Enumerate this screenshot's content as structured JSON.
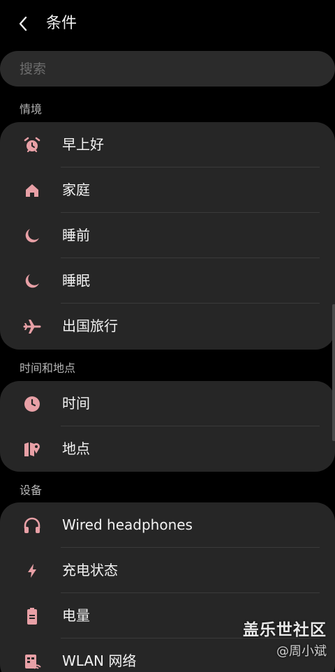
{
  "header": {
    "title": "条件",
    "back_icon": "chevron-left-icon"
  },
  "search": {
    "placeholder": "搜索"
  },
  "accent_color": "#e8a0a6",
  "sections": [
    {
      "label": "情境",
      "items": [
        {
          "label": "早上好",
          "icon": "alarm-clock-icon"
        },
        {
          "label": "家庭",
          "icon": "home-icon"
        },
        {
          "label": "睡前",
          "icon": "moon-icon"
        },
        {
          "label": "睡眠",
          "icon": "moon-icon"
        },
        {
          "label": "出国旅行",
          "icon": "airplane-icon"
        }
      ]
    },
    {
      "label": "时间和地点",
      "items": [
        {
          "label": "时间",
          "icon": "clock-icon"
        },
        {
          "label": "地点",
          "icon": "map-pin-icon"
        }
      ]
    },
    {
      "label": "设备",
      "items": [
        {
          "label": "Wired headphones",
          "icon": "headphones-icon"
        },
        {
          "label": "充电状态",
          "icon": "lightning-icon"
        },
        {
          "label": "电量",
          "icon": "battery-icon"
        },
        {
          "label": "WLAN 网络",
          "icon": "wifi-icon"
        }
      ]
    }
  ],
  "watermark": {
    "title": "盖乐世社区",
    "user": "@周小斌"
  }
}
